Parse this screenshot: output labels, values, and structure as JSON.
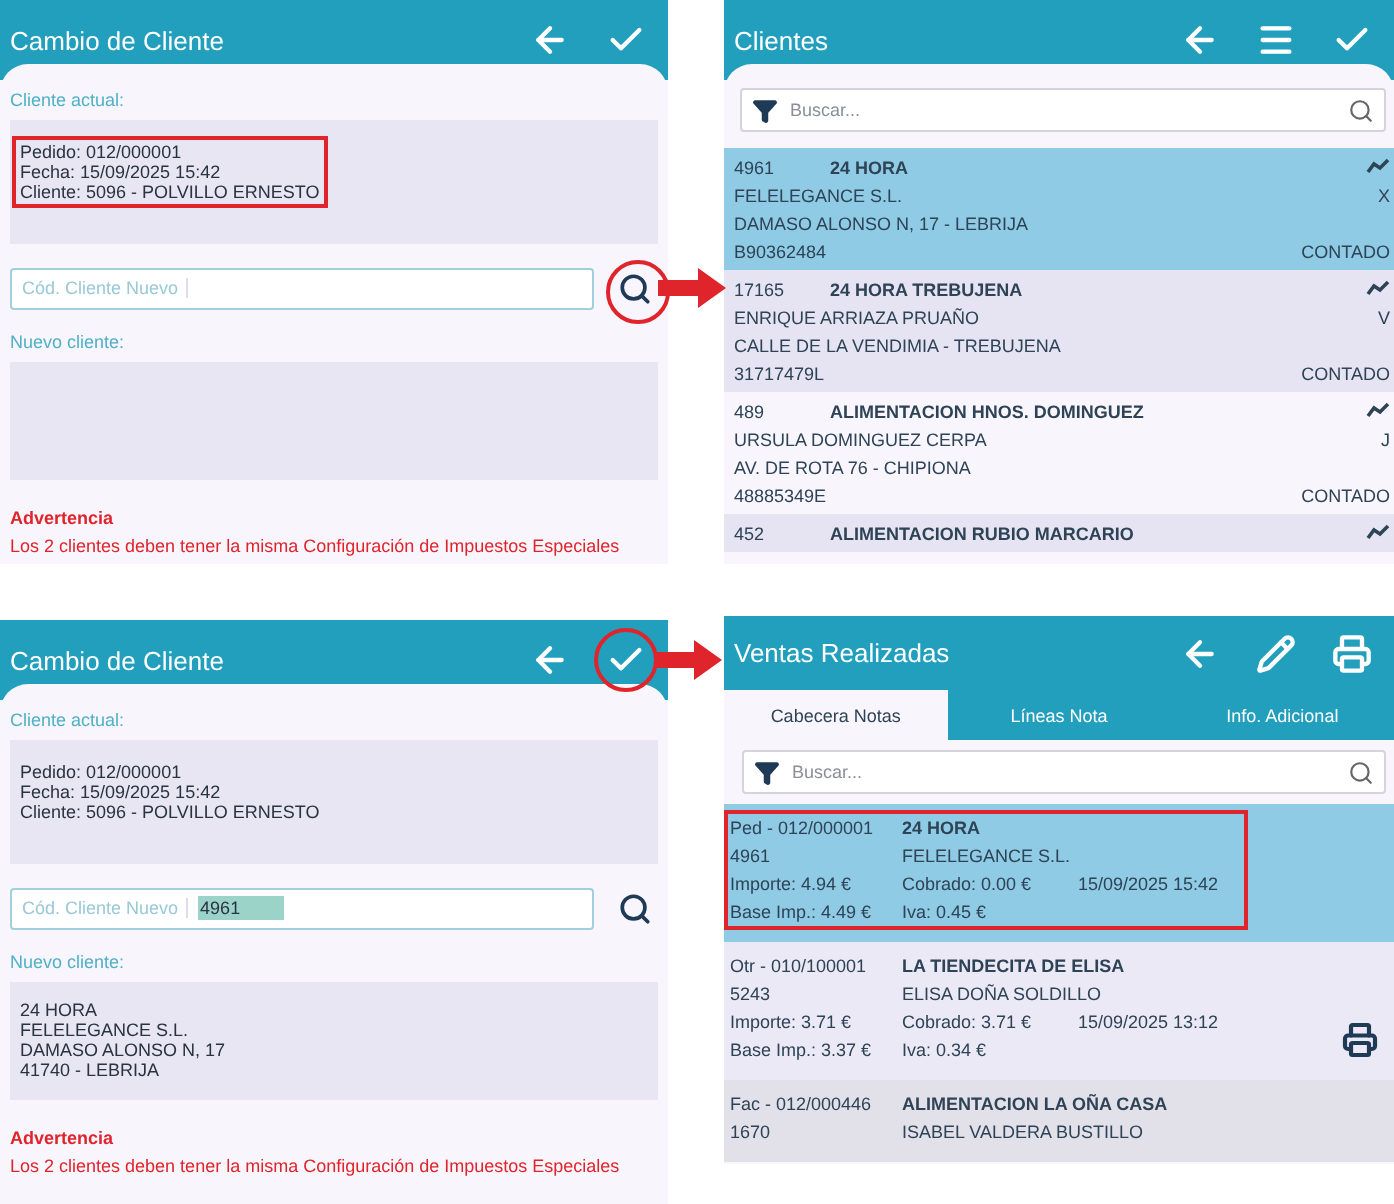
{
  "panels": [
    {
      "kind": "change_client",
      "title": "Cambio de Cliente",
      "actions": [
        {
          "kind": "back",
          "circled": false
        },
        {
          "kind": "confirm",
          "circled": false
        }
      ],
      "current_label": "Cliente actual:",
      "current_lines": [
        "Pedido: 012/000001",
        "Fecha: 15/09/2025 15:42",
        "Cliente: 5096 - POLVILLO ERNESTO"
      ],
      "current_highlighted": true,
      "code_field": {
        "label": "Cód. Cliente Nuevo"
      },
      "search_circled": true,
      "new_label": "Nuevo cliente:",
      "warning_title": "Advertencia",
      "warning_text": "Los 2 clientes deben tener la misma Configuración de Impuestos Especiales"
    },
    {
      "kind": "client_list",
      "title": "Clientes",
      "actions": [
        {
          "kind": "back",
          "circled": false
        },
        {
          "kind": "menu",
          "circled": false
        },
        {
          "kind": "confirm",
          "circled": false
        }
      ],
      "search": {
        "placeholder": "Buscar..."
      },
      "rows": [
        {
          "code": "4961",
          "name": "24 HORA",
          "company": "FELELEGANCE S.L.",
          "route": "X",
          "address": "DAMASO ALONSO  N, 17 - LEBRIJA",
          "tax_id": "B90362484",
          "payment": "CONTADO",
          "selected": true
        },
        {
          "code": "17165",
          "name": "24 HORA TREBUJENA",
          "company": "ENRIQUE ARRIAZA PRUAÑO",
          "route": "V",
          "address": "CALLE DE LA VENDIMIA - TREBUJENA",
          "tax_id": "31717479L",
          "payment": "CONTADO",
          "selected": false
        },
        {
          "code": "489",
          "name": "ALIMENTACION  HNOS. DOMINGUEZ",
          "company": "URSULA DOMINGUEZ CERPA",
          "route": "J",
          "address": "AV. DE ROTA 76 - CHIPIONA",
          "tax_id": "48885349E",
          "payment": "CONTADO",
          "selected": false
        },
        {
          "code": "452",
          "name": "ALIMENTACION  RUBIO MARCARIO",
          "selected": false
        }
      ]
    },
    {
      "kind": "change_client",
      "title": "Cambio de Cliente",
      "actions": [
        {
          "kind": "back",
          "circled": false
        },
        {
          "kind": "confirm",
          "circled": true
        }
      ],
      "current_label": "Cliente actual:",
      "current_lines": [
        "Pedido: 012/000001",
        "Fecha: 15/09/2025 15:42",
        "Cliente: 5096 - POLVILLO ERNESTO"
      ],
      "current_highlighted": false,
      "code_field": {
        "label": "Cód. Cliente Nuevo",
        "value": "4961",
        "value_selected": true
      },
      "search_circled": false,
      "new_label": "Nuevo cliente:",
      "new_lines": [
        "24 HORA",
        "FELELEGANCE S.L.",
        "DAMASO ALONSO  N, 17",
        "41740 - LEBRIJA"
      ],
      "warning_title": "Advertencia",
      "warning_text": "Los 2 clientes deben tener la misma Configuración de Impuestos Especiales"
    },
    {
      "kind": "sales_list",
      "title": "Ventas Realizadas",
      "actions": [
        {
          "kind": "back",
          "circled": false
        },
        {
          "kind": "edit",
          "circled": false
        },
        {
          "kind": "print",
          "circled": false
        }
      ],
      "tabs": [
        {
          "label": "Cabecera Notas",
          "selected": true
        },
        {
          "label": "Líneas Nota",
          "selected": false
        },
        {
          "label": "Info. Adicional",
          "selected": false
        }
      ],
      "search": {
        "placeholder": "Buscar..."
      },
      "rows": [
        {
          "doc": "Ped - 012/000001",
          "name": "24 HORA",
          "code": "4961",
          "customer": "FELELEGANCE S.L.",
          "amount": "Importe: 4.94 €",
          "paid": "Cobrado: 0.00 €",
          "date": "15/09/2025 15:42",
          "base": "Base Imp.: 4.49 €",
          "vat": "Iva: 0.45 €",
          "selected": true,
          "highlighted": true,
          "printable": false
        },
        {
          "doc": "Otr - 010/100001",
          "name": "LA TIENDECITA DE ELISA",
          "code": "5243",
          "customer": "ELISA DOÑA SOLDILLO",
          "amount": "Importe: 3.71 €",
          "paid": "Cobrado: 3.71 €",
          "date": "15/09/2025 13:12",
          "base": "Base Imp.: 3.37 €",
          "vat": "Iva: 0.34 €",
          "selected": false,
          "highlighted": false,
          "printable": true
        },
        {
          "doc": "Fac - 012/000446",
          "name": "ALIMENTACION LA OÑA CASA",
          "code": "1670",
          "customer": "ISABEL VALDERA BUSTILLO",
          "selected": false,
          "highlighted": false,
          "printable": false
        }
      ]
    }
  ]
}
